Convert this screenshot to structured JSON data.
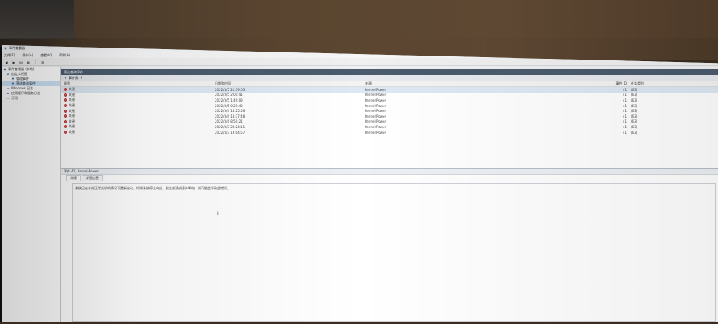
{
  "window": {
    "title": "事件查看器"
  },
  "menu": [
    {
      "label": "文件(F)"
    },
    {
      "label": "操作(A)"
    },
    {
      "label": "查看(V)"
    },
    {
      "label": "帮助(H)"
    }
  ],
  "toolbar": {
    "back_icon": "back-arrow-icon",
    "forward_icon": "forward-arrow-icon"
  },
  "tree": {
    "items": [
      {
        "label": "事件查看器 (本地)",
        "icon": "event-viewer-icon",
        "indent": 0
      },
      {
        "label": "自定义视图",
        "icon": "folder-icon",
        "indent": 1
      },
      {
        "label": "管理事件",
        "icon": "filter-icon",
        "indent": 2
      },
      {
        "label": "筛选查询事件",
        "icon": "filter-icon",
        "indent": 2
      },
      {
        "label": "Windows 日志",
        "icon": "folder-icon",
        "indent": 1
      },
      {
        "label": "应用程序和服务日志",
        "icon": "folder-icon",
        "indent": 1
      },
      {
        "label": "订阅",
        "icon": "subscription-icon",
        "indent": 1
      }
    ]
  },
  "panel": {
    "header": "筛选查询事件",
    "tab_label": "事件数: 9",
    "columns": {
      "level": "级别",
      "date": "日期和时间",
      "source": "来源",
      "id": "事件 ID",
      "task": "任务类别"
    },
    "rows": [
      {
        "level": "关键",
        "date": "2022/3/5 21:39:03",
        "source": "Kernel-Power",
        "id": "41",
        "task": "(63)"
      },
      {
        "level": "关键",
        "date": "2022/3/5 2:01:41",
        "source": "Kernel-Power",
        "id": "41",
        "task": "(63)"
      },
      {
        "level": "关键",
        "date": "2022/3/5 1:49:09",
        "source": "Kernel-Power",
        "id": "41",
        "task": "(63)"
      },
      {
        "level": "关键",
        "date": "2022/3/5 0:29:43",
        "source": "Kernel-Power",
        "id": "41",
        "task": "(63)"
      },
      {
        "level": "关键",
        "date": "2022/3/4 14:25:56",
        "source": "Kernel-Power",
        "id": "41",
        "task": "(63)"
      },
      {
        "level": "关键",
        "date": "2022/3/4 13:37:48",
        "source": "Kernel-Power",
        "id": "41",
        "task": "(63)"
      },
      {
        "level": "关键",
        "date": "2022/3/4 8:50:21",
        "source": "Kernel-Power",
        "id": "41",
        "task": "(63)"
      },
      {
        "level": "关键",
        "date": "2022/3/3 23:24:11",
        "source": "Kernel-Power",
        "id": "41",
        "task": "(63)"
      },
      {
        "level": "关键",
        "date": "2022/3/3 19:04:57",
        "source": "Kernel-Power",
        "id": "41",
        "task": "(63)"
      }
    ]
  },
  "detail": {
    "header": "事件 41, Kernel-Power",
    "tabs": [
      "常规",
      "详细信息"
    ],
    "message": "系统已在未先正常关机的情况下重新启动。如果系统停止响应、发生崩溃或意外断电，则可能会导致此错误。"
  }
}
